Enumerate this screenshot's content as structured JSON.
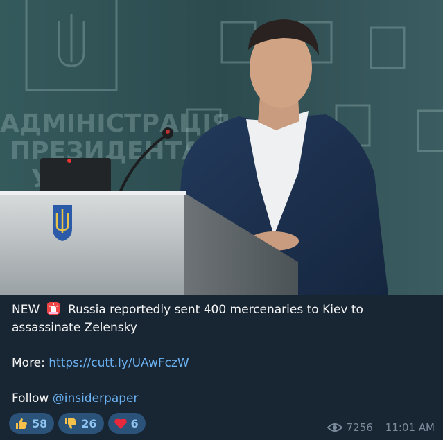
{
  "photo": {
    "alt_signage_1": "АДМІНІСТРАЦІЯ",
    "alt_signage_2": "ПРЕЗИДЕНТА",
    "alt_signage_3": "У"
  },
  "message": {
    "headline_prefix": "NEW",
    "headline_text": "Russia reportedly sent 400 mercenaries to Kiev to",
    "headline_text_2": "assassinate Zelensky",
    "more_label": "More:",
    "more_link": "https://cutt.ly/UAwFczW",
    "follow_label": "Follow",
    "follow_handle": "@insiderpaper"
  },
  "reactions": [
    {
      "icon": "thumbs-up-icon",
      "count": "58"
    },
    {
      "icon": "thumbs-down-icon",
      "count": "26"
    },
    {
      "icon": "heart-icon",
      "count": "6"
    }
  ],
  "meta": {
    "views": "7256",
    "time": "11:01 AM"
  },
  "colors": {
    "background": "#182533",
    "link": "#6ab2f2",
    "reaction_bg": "#2b5278",
    "meta_text": "#7b8b9c"
  }
}
